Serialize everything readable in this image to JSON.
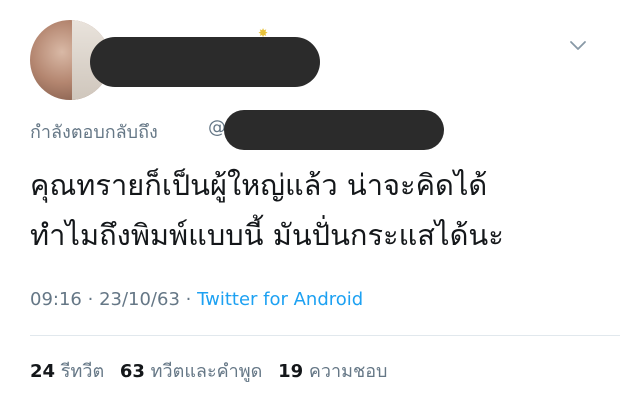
{
  "tweet": {
    "reply_prefix": "กำลังตอบกลับถึง",
    "reply_at": "@",
    "text_lines": [
      "คุณทรายก็เป็นผู้ใหญ่แล้ว  น่าจะคิดได้",
      "ทำไมถึงพิมพ์แบบนี้ มันปั่นกระแสได้นะ"
    ],
    "time": "09:16",
    "date": "23/10/63",
    "separator": "·",
    "source": "Twitter for Android",
    "retweets": {
      "count": "24",
      "label": "รีทวีต"
    },
    "quotes": {
      "count": "63",
      "label": "ทวีตและคำพูด"
    },
    "likes": {
      "count": "19",
      "label": "ความชอบ"
    }
  },
  "icons": {
    "more": "chevron-down-icon"
  },
  "colors": {
    "text": "#14171a",
    "secondary": "#657786",
    "link": "#1da1f2",
    "redaction": "#2b2b2b"
  }
}
